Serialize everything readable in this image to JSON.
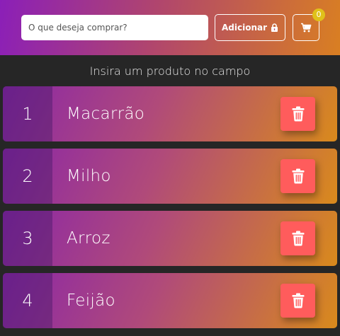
{
  "header": {
    "search": {
      "placeholder": "O que deseja comprar?",
      "value": ""
    },
    "add_button": {
      "label": "Adicionar",
      "icon": "lock-icon"
    },
    "cart": {
      "icon": "cart-icon",
      "count": "0"
    }
  },
  "hint_text": "Insira um produto no campo",
  "items": [
    {
      "number": "1",
      "name": "Macarrão"
    },
    {
      "number": "2",
      "name": "Milho"
    },
    {
      "number": "3",
      "name": "Arroz"
    },
    {
      "number": "4",
      "name": "Feijão"
    }
  ],
  "delete_icon": "trash-icon",
  "colors": {
    "background": "#262626",
    "gradient_start": "#8b1fb8",
    "gradient_end": "#d97f22",
    "delete_button": "#ff5c5c",
    "badge": "#e0c11a"
  }
}
